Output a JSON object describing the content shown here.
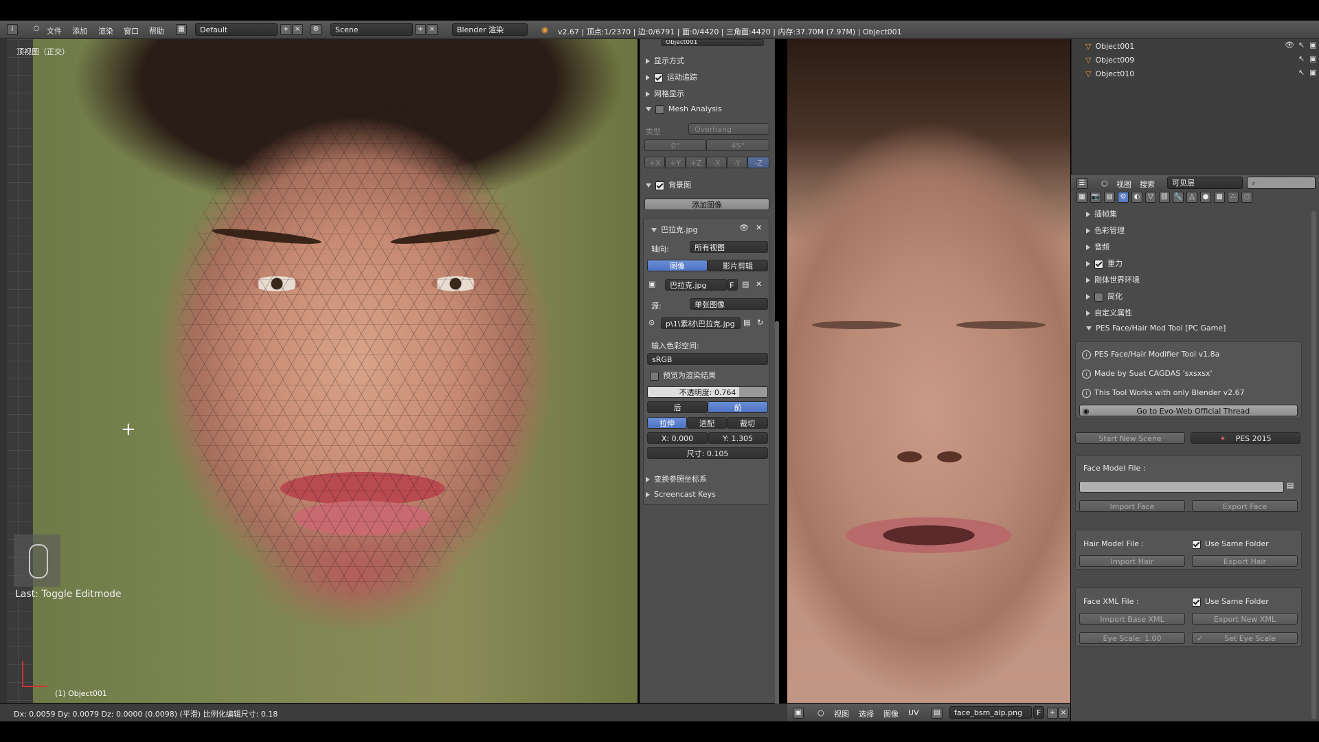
{
  "header": {
    "menus": [
      "文件",
      "添加",
      "渲染",
      "窗口",
      "帮助"
    ],
    "layout_name": "Default",
    "scene_name": "Scene",
    "render_engine": "Blender 渲染",
    "stats": "v2.67 | 顶点:1/2370 | 边:0/6791 | 面:0/4420 | 三角面:4420 | 内存:37.70M (7.97M) | Object001"
  },
  "viewport": {
    "view_title": "顶视图（正交）",
    "last_operator": "Last: Toggle Editmode",
    "object_label": "(1) Object001",
    "status_text": "Dx: 0.0059   Dy: 0.0079  Dz: 0.0000 (0.0098) (平滑) 比例化编辑尺寸: 0.18"
  },
  "npanel": {
    "object_field": "Object001",
    "sections": {
      "display": "显示方式",
      "motion": "运动追踪",
      "mesh_display": "网格显示",
      "mesh_analysis": "Mesh Analysis",
      "type_label": "类型",
      "type_value": "Overhang",
      "angle_min": "0°",
      "angle_max": "45°",
      "axes": [
        "+X",
        "+Y",
        "+Z",
        "-X",
        "-Y",
        "-Z"
      ],
      "background": "背景图",
      "add_image": "添加图像",
      "image_name": "巴拉克.jpg",
      "axis_label": "轴向:",
      "axis_value": "所有视图",
      "tab_image": "图像",
      "tab_clip": "影片剪辑",
      "image_field": "巴拉克.jpg",
      "image_f": "F",
      "source_label": "源:",
      "source_value": "单张图像",
      "filepath": "p\\1\\素材\\巴拉克.jpg",
      "colorspace_label": "输入色彩空间:",
      "colorspace_value": "sRGB",
      "render_preview": "预览为渲染结果",
      "opacity": "不透明度: 0.764",
      "back": "后",
      "front": "前",
      "stretch": "拉伸",
      "fit": "适配",
      "crop": "裁切",
      "x_val": "X: 0.000",
      "y_val": "Y: 1.305",
      "size": "尺寸: 0.105",
      "transform_orient": "变换参照坐标系",
      "screencast": "Screencast Keys"
    }
  },
  "image_editor": {
    "menus": [
      "视图",
      "选择",
      "图像",
      "UV"
    ],
    "image_name": "face_bsm_alp.png",
    "f_label": "F"
  },
  "outliner": {
    "objects": [
      "Object001",
      "Object009",
      "Object010"
    ]
  },
  "properties": {
    "header_menus": [
      "视图",
      "搜索"
    ],
    "layer_filter": "可见层",
    "sections": [
      "插帧集",
      "色彩管理",
      "音频",
      "重力",
      "刚体世界环境",
      "简化",
      "自定义属性"
    ],
    "pes_panel_title": "PES Face/Hair Mod Tool [PC Game]",
    "info_lines": [
      "PES Face/Hair Modifier Tool v1.8a",
      "Made by Suat CAGDAS 'sxsxsx'",
      "This Tool Works with only Blender v2.67"
    ],
    "evo_button": "Go to Evo-Web Official Thread",
    "start_scene": "Start New Scene",
    "pes_version": "PES 2015",
    "face_model_label": "Face Model File :",
    "import_face": "Import Face",
    "export_face": "Export Face",
    "hair_model_label": "Hair Model File :",
    "use_same_folder": "Use Same Folder",
    "import_hair": "Import Hair",
    "export_hair": "Export Hair",
    "face_xml_label": "Face XML File :",
    "import_base_xml": "Import Base XML",
    "export_new_xml": "Export New XML",
    "eye_scale": "Eye Scale: 1.00",
    "set_eye_scale": "Set Eye Scale"
  }
}
